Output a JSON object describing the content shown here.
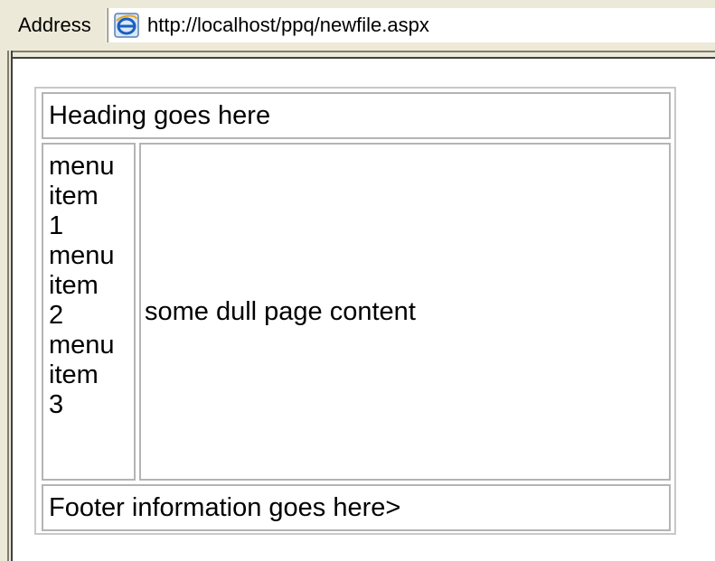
{
  "address_bar": {
    "label": "Address",
    "url": "http://localhost/ppq/newfile.aspx",
    "page_icon": "internet-explorer-icon"
  },
  "page": {
    "heading": "Heading goes here",
    "menu_items": [
      "menu item 1",
      "menu item 2",
      "menu item 3"
    ],
    "content": "some dull page content",
    "footer": "Footer information goes here>"
  }
}
